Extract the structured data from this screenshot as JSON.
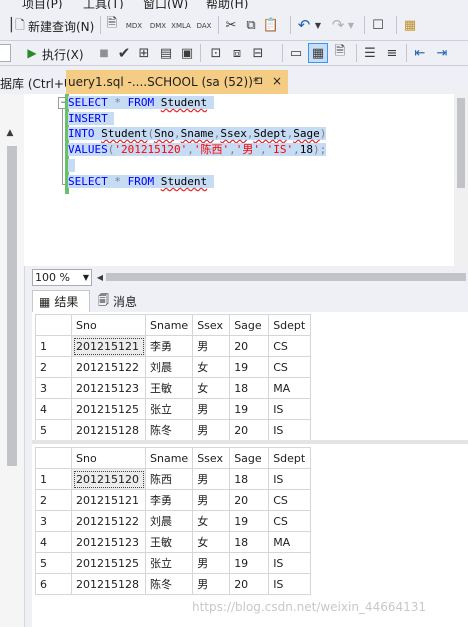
{
  "menu": {
    "items": [
      "项目(P)",
      "工具(T)",
      "窗口(W)",
      "帮助(H)"
    ]
  },
  "toolbar": {
    "new_query_label": "新建查询(N)",
    "mdx_label": "MDX",
    "dmx_label": "DMX",
    "xmla_label": "XMLA",
    "dax_label": "DAX",
    "execute_label": "执行(X)"
  },
  "tabs": {
    "left_tab_label": "据库 (Ctrl+U)",
    "active_tab_label": "uery1.sql -....SCHOOL (sa (52))*",
    "pin_symbol": "⊐",
    "close_symbol": "×"
  },
  "editor": {
    "lines": {
      "l1_kw1": "SELECT",
      "l1_star": "*",
      "l1_kw2": "FROM",
      "l1_table": "Student",
      "l2_kw": "INSERT",
      "l3_kw": "INTO",
      "l3_table": "Student",
      "l3_open": "(",
      "l3_c1": "Sno",
      "l3_c2": "Sname",
      "l3_c3": "Ssex",
      "l3_c4": "Sdept",
      "l3_c5": "Sage",
      "l3_close": ")",
      "l3_comma": ",",
      "l4_kw": "VALUES",
      "l4_open": "(",
      "l4_v1": "'201215120'",
      "l4_v2": "'陈西'",
      "l4_v3": "'男'",
      "l4_v4": "'IS'",
      "l4_v5": "18",
      "l4_close": ");",
      "l4_comma": ",",
      "l6_kw1": "SELECT",
      "l6_star": "*",
      "l6_kw2": "FROM",
      "l6_table": "Student"
    }
  },
  "zoom": {
    "value": "100 %"
  },
  "result_tabs": {
    "results_label": "结果",
    "messages_label": "消息"
  },
  "grid1": {
    "headers": [
      "Sno",
      "Sname",
      "Ssex",
      "Sage",
      "Sdept"
    ],
    "rows": [
      [
        "1",
        "201215121",
        "李勇",
        "男",
        "20",
        "CS"
      ],
      [
        "2",
        "201215122",
        "刘晨",
        "女",
        "19",
        "CS"
      ],
      [
        "3",
        "201215123",
        "王敏",
        "女",
        "18",
        "MA"
      ],
      [
        "4",
        "201215125",
        "张立",
        "男",
        "19",
        "IS"
      ],
      [
        "5",
        "201215128",
        "陈冬",
        "男",
        "20",
        "IS"
      ]
    ]
  },
  "grid2": {
    "headers": [
      "Sno",
      "Sname",
      "Ssex",
      "Sage",
      "Sdept"
    ],
    "rows": [
      [
        "1",
        "201215120",
        "陈西",
        "男",
        "18",
        "IS"
      ],
      [
        "2",
        "201215121",
        "李勇",
        "男",
        "20",
        "CS"
      ],
      [
        "3",
        "201215122",
        "刘晨",
        "女",
        "19",
        "CS"
      ],
      [
        "4",
        "201215123",
        "王敏",
        "女",
        "18",
        "MA"
      ],
      [
        "5",
        "201215125",
        "张立",
        "男",
        "19",
        "IS"
      ],
      [
        "6",
        "201215128",
        "陈冬",
        "男",
        "20",
        "IS"
      ]
    ]
  },
  "watermark": "https://blog.csdn.net/weixin_44664131",
  "colors": {
    "active_tab": "#f5cc84",
    "selection": "#c6dcf5",
    "keyword": "#0000ff",
    "string": "#ff0000"
  }
}
